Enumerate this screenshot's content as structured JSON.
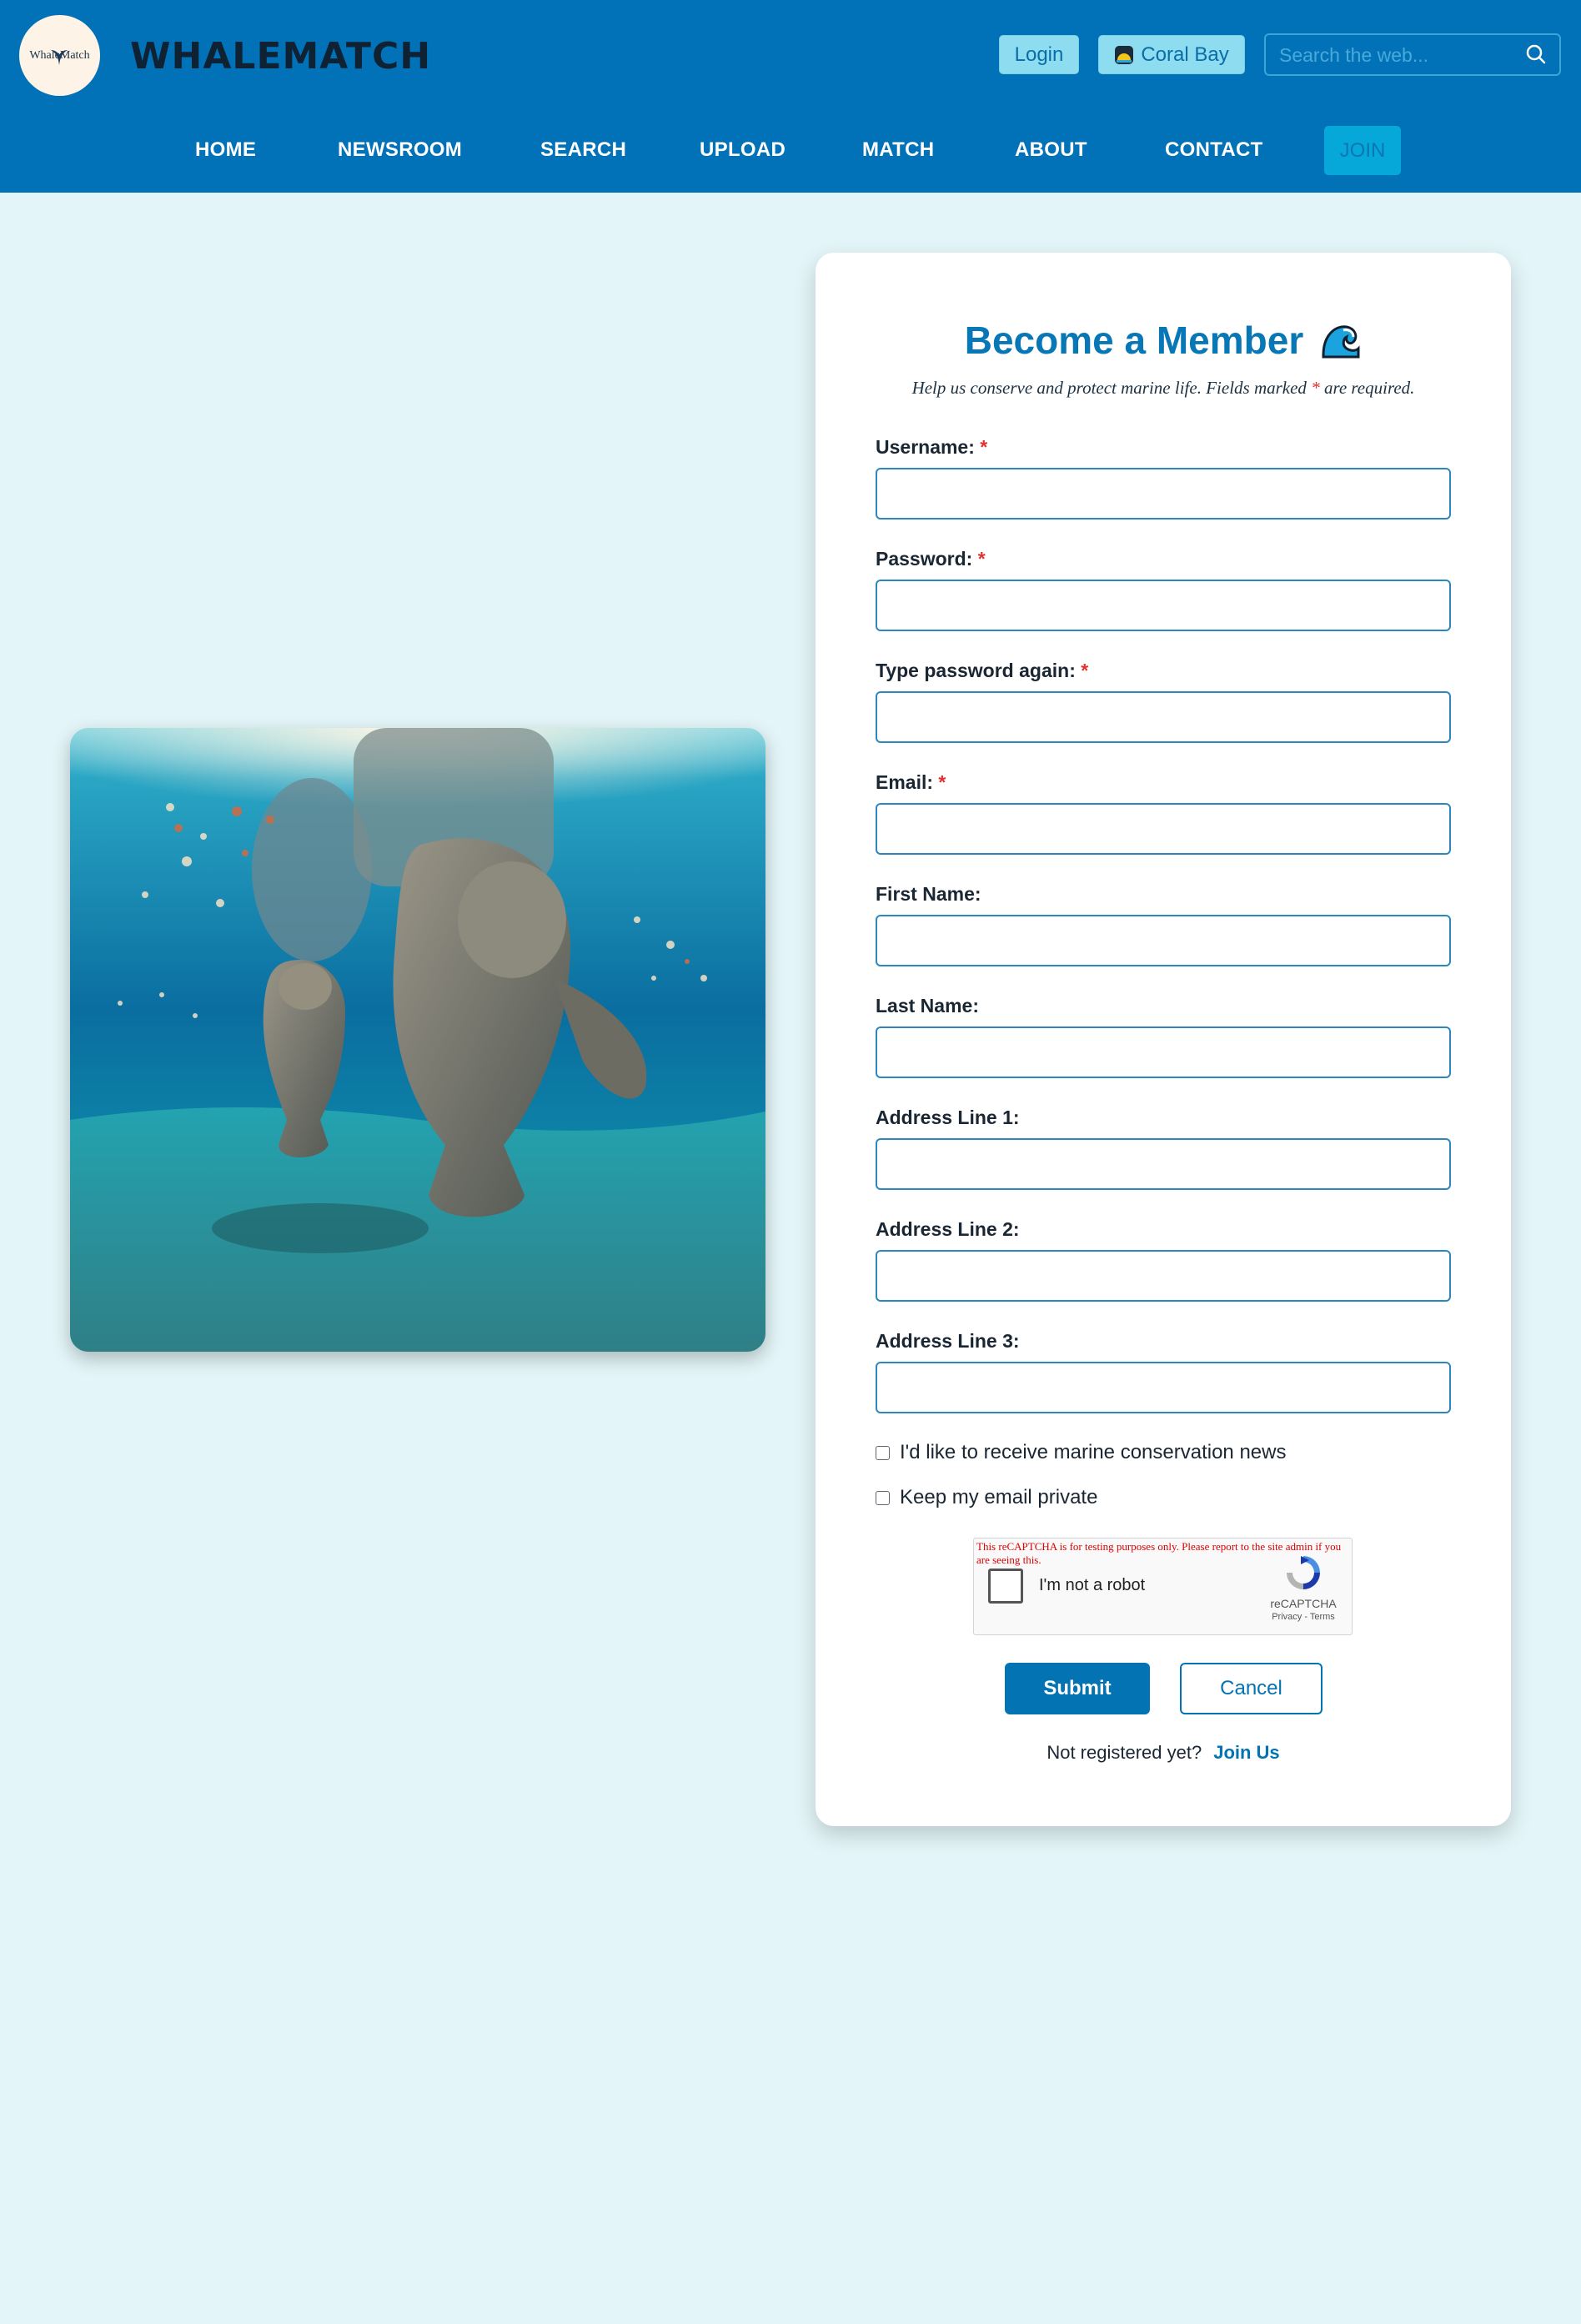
{
  "header": {
    "logo_text": "WhaleMatch",
    "brand": "WHALEMATCH",
    "login_label": "Login",
    "location_label": "Coral Bay",
    "search_placeholder": "Search the web...",
    "colors": {
      "bar": "#0272b8",
      "accent_button": "#8ddcf0",
      "join_button": "#05a8d8"
    }
  },
  "nav": {
    "items": [
      "HOME",
      "NEWSROOM",
      "SEARCH",
      "UPLOAD",
      "MATCH",
      "ABOUT",
      "CONTACT"
    ],
    "join_label": "JOIN"
  },
  "photo": {
    "subject": "manatees-underwater-photo"
  },
  "form": {
    "title": "Become a Member",
    "title_icon": "wave-icon",
    "subtitle_before": "Help us conserve and protect marine life. Fields marked ",
    "subtitle_star": "*",
    "subtitle_after": " are required.",
    "required_mark": "*",
    "fields": [
      {
        "label": "Username:",
        "required": true,
        "value": ""
      },
      {
        "label": "Password:",
        "required": true,
        "value": ""
      },
      {
        "label": "Type password again:",
        "required": true,
        "value": ""
      },
      {
        "label": "Email:",
        "required": true,
        "value": ""
      },
      {
        "label": "First Name:",
        "required": false,
        "value": ""
      },
      {
        "label": "Last Name:",
        "required": false,
        "value": ""
      },
      {
        "label": "Address Line 1:",
        "required": false,
        "value": ""
      },
      {
        "label": "Address Line 2:",
        "required": false,
        "value": ""
      },
      {
        "label": "Address Line 3:",
        "required": false,
        "value": ""
      }
    ],
    "checkboxes": [
      {
        "label": "I'd like to receive marine conservation news",
        "checked": false
      },
      {
        "label": "Keep my email private",
        "checked": false
      }
    ],
    "recaptcha": {
      "warning": "This reCAPTCHA is for testing purposes only. Please report to the site admin if you are seeing this.",
      "label": "I'm not a robot",
      "brand": "reCAPTCHA",
      "links": "Privacy - Terms"
    },
    "submit_label": "Submit",
    "cancel_label": "Cancel",
    "footer_text": "Not registered yet?",
    "footer_link": "Join Us"
  }
}
